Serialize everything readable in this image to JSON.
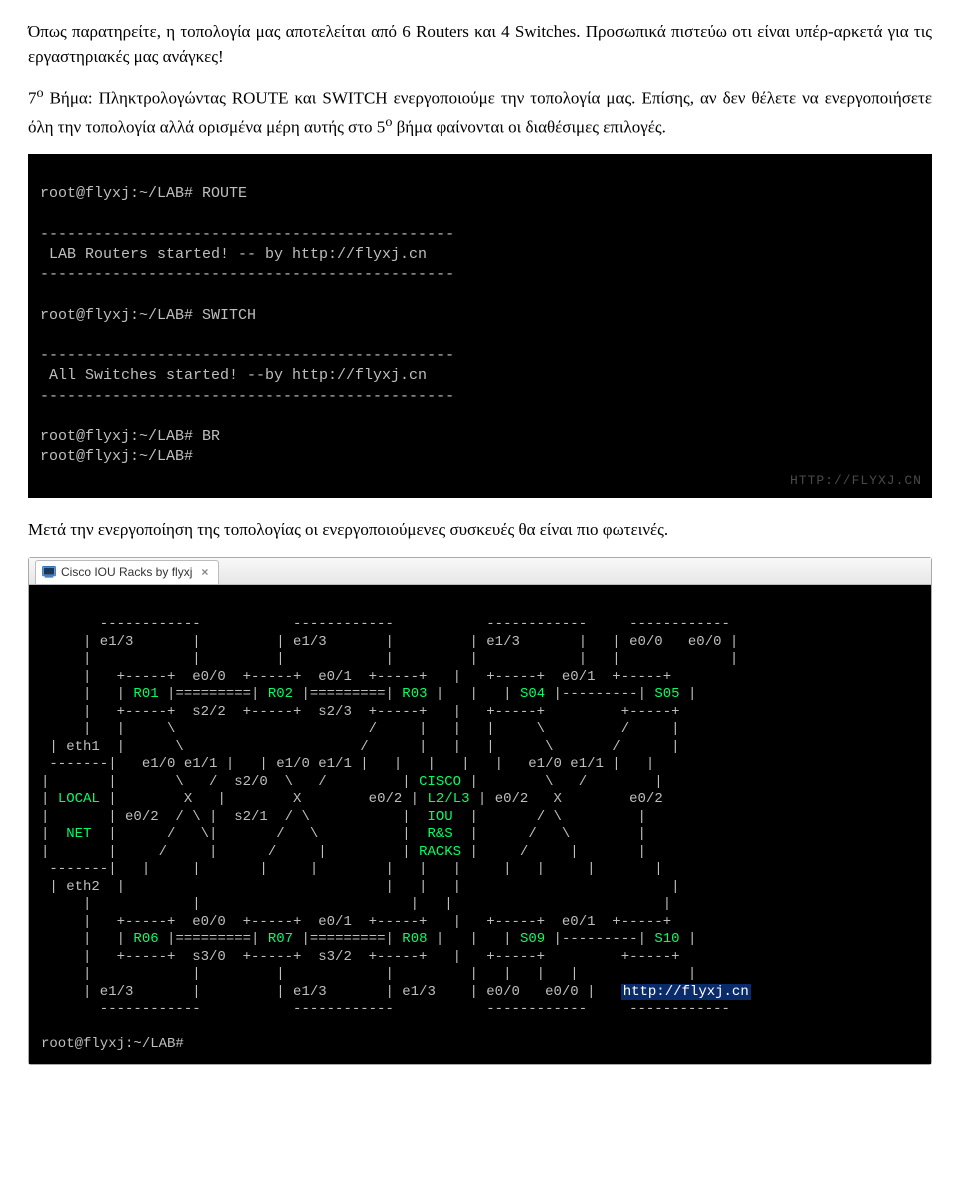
{
  "para1_a": "Όπως παρατηρείτε, η τοπολογία μας αποτελείται από 6 Routers και 4 Switches. Προσωπικά πιστεύω οτι είναι υπέρ-αρκετά για τις εργαστηριακές μας ανάγκες!",
  "para2_pre": "7",
  "para2_sup": "ο",
  "para2_mid_a": " Βήμα: Πληκτρολογώντας ROUTE και SWITCH ενεργοποιούμε την τοπολογία μας. Επίσης, αν δεν θέλετε να ενεργοποιήσετε όλη την τοπολογία αλλά ορισμένα μέρη αυτής στο 5",
  "para2_sup2": "ο",
  "para2_mid_b": " βήμα φαίνονται οι διαθέσιμες επιλογές.",
  "term1_l1": "root@flyxj:~/LAB# ROUTE",
  "term1_l2": "",
  "term1_l3": "----------------------------------------------",
  "term1_l4": " LAB Routers started! -- by http://flyxj.cn",
  "term1_l5": "----------------------------------------------",
  "term1_l6": "",
  "term1_l7": "root@flyxj:~/LAB# SWITCH",
  "term1_l8": "",
  "term1_l9": "----------------------------------------------",
  "term1_l10": " All Switches started! --by http://flyxj.cn",
  "term1_l11": "----------------------------------------------",
  "term1_l12": "",
  "term1_l13": "root@flyxj:~/LAB# BR",
  "term1_l14": "root@flyxj:~/LAB#",
  "watermark": "HTTP://FLYXJ.CN",
  "para3": "Μετά την ενεργοποίηση της τοπολογίας οι ενεργοποιούμενες συσκευές θα είναι πιο φωτεινές.",
  "tab_title": "Cisco IOU Racks by flyxj",
  "tab_close": "×",
  "racks_prompt": "root@flyxj:~/LAB#",
  "racks_link": "http://flyxj.cn",
  "r": {
    "l01": "       ------------           ------------           ------------     ------------",
    "l02": "     | e1/3       |         | e1/3       |         | e1/3       |   | e0/0   e0/0 |",
    "l03": "     |            |         |            |         |            |   |             |",
    "l04_a": "     |   +-----+  e0/0  +-----+  e0/1  +-----+   |   +-----+  e0/1  +-----+",
    "l05_a": "     |   | ",
    "l05_r01": "R01",
    "l05_b": " |=========| ",
    "l05_r02": "R02",
    "l05_c": " |=========| ",
    "l05_r03": "R03",
    "l05_d": " |   |   | ",
    "l05_s04": "S04",
    "l05_e": " |---------| ",
    "l05_s05": "S05",
    "l05_f": " |",
    "l06": "     |   +-----+  s2/2  +-----+  s2/3  +-----+   |   +-----+         +-----+",
    "l07": "     |   |     \\                       /     |   |   |     \\         /     |",
    "l08": " | eth1  |      \\                     /      |   |   |      \\       /      |",
    "l09": " -------|   e1/0 e1/1 |   | e1/0 e1/1 |   |   |   |   |   e1/0 e1/1 |   |",
    "l10_a": "|       |       \\   /  s2/0  \\   /         | ",
    "l10_cisco": "CISCO",
    "l10_b": " |        \\   /        |",
    "l11_a": "| ",
    "l11_local": "LOCAL",
    "l11_b": " |        X   |        X        e0/2 | ",
    "l11_l2l3": "L2/L3",
    "l11_c": " | e0/2   X        e0/2",
    "l12_a": "|       | e0/2  / \\ |  s2/1  / \\           | ",
    "l12_iou": " IOU ",
    "l12_b": " |       / \\         |",
    "l13_a": "|  ",
    "l13_net": "NET",
    "l13_b": "  |      /   \\|       /   \\          | ",
    "l13_rs": " R&S ",
    "l13_c": " |      /   \\        |",
    "l14_a": "|       |     /     |      /     |         | ",
    "l14_racks": "RACKS",
    "l14_b": " |     /     |       |",
    "l15": " -------|   |     |       |     |        |   |   |     |   |     |       |",
    "l16": " | eth2  |                               |   |   |                         |",
    "l17": "     |            |                         |   |                         |",
    "l18": "     |   +-----+  e0/0  +-----+  e0/1  +-----+   |   +-----+  e0/1  +-----+",
    "l19_a": "     |   | ",
    "l19_r06": "R06",
    "l19_b": " |=========| ",
    "l19_r07": "R07",
    "l19_c": " |=========| ",
    "l19_r08": "R08",
    "l19_d": " |   |   | ",
    "l19_s09": "S09",
    "l19_e": " |---------| ",
    "l19_s10": "S10",
    "l19_f": " |",
    "l20": "     |   +-----+  s3/0  +-----+  s3/2  +-----+   |   +-----+         +-----+",
    "l21": "     |            |         |            |         |   |   |   |             |",
    "l22_a": "     | e1/3       |         | e1/3       | e1/3    | e0/0   e0/0 |   ",
    "l23": "       ------------           ------------           ------------     ------------"
  }
}
